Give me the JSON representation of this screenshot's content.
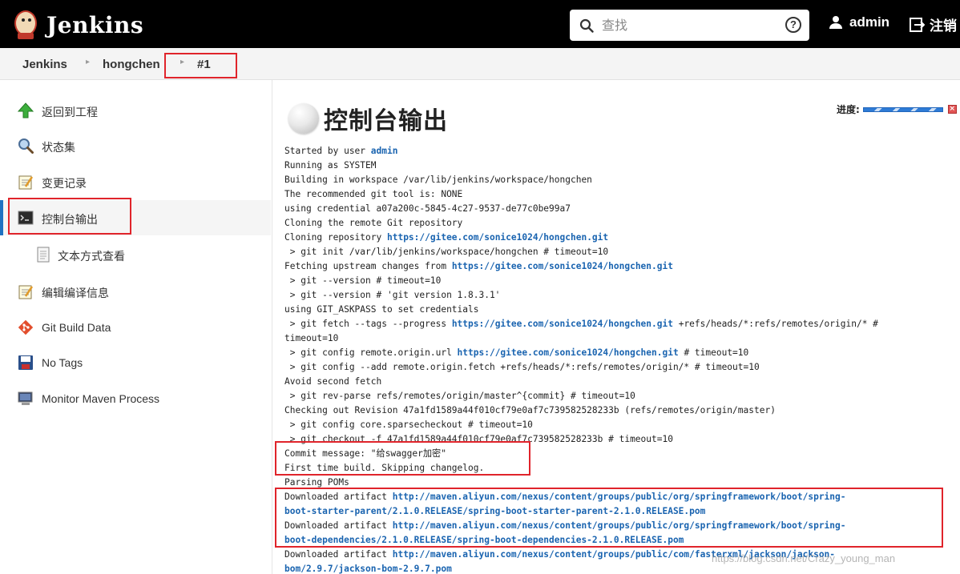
{
  "header": {
    "logo_text": "Jenkins",
    "search_placeholder": "查找",
    "help_label": "?",
    "user_label": "admin",
    "logout_label": "注销"
  },
  "breadcrumb": {
    "items": [
      "Jenkins",
      "hongchen",
      "#1"
    ]
  },
  "sidebar": {
    "items": [
      {
        "label": "返回到工程",
        "icon": "up-arrow-icon"
      },
      {
        "label": "状态集",
        "icon": "magnifier-icon"
      },
      {
        "label": "变更记录",
        "icon": "notepad-icon"
      },
      {
        "label": "控制台输出",
        "icon": "terminal-icon"
      },
      {
        "label": "文本方式查看",
        "icon": "document-icon"
      },
      {
        "label": "编辑编译信息",
        "icon": "notepad-icon"
      },
      {
        "label": "Git Build Data",
        "icon": "git-icon"
      },
      {
        "label": "No Tags",
        "icon": "save-icon"
      },
      {
        "label": "Monitor Maven Process",
        "icon": "monitor-icon"
      }
    ]
  },
  "main": {
    "title": "控制台输出",
    "progress_label": "进度:",
    "console_lines": [
      [
        {
          "t": "Started by user "
        },
        {
          "l": "admin"
        }
      ],
      [
        {
          "t": "Running as SYSTEM"
        }
      ],
      [
        {
          "t": "Building in workspace /var/lib/jenkins/workspace/hongchen"
        }
      ],
      [
        {
          "t": "The recommended git tool is: NONE"
        }
      ],
      [
        {
          "t": "using credential a07a200c-5845-4c27-9537-de77c0be99a7"
        }
      ],
      [
        {
          "t": "Cloning the remote Git repository"
        }
      ],
      [
        {
          "t": "Cloning repository "
        },
        {
          "l": "https://gitee.com/sonice1024/hongchen.git"
        }
      ],
      [
        {
          "t": " > git init /var/lib/jenkins/workspace/hongchen # timeout=10"
        }
      ],
      [
        {
          "t": "Fetching upstream changes from "
        },
        {
          "l": "https://gitee.com/sonice1024/hongchen.git"
        }
      ],
      [
        {
          "t": " > git --version # timeout=10"
        }
      ],
      [
        {
          "t": " > git --version # 'git version 1.8.3.1'"
        }
      ],
      [
        {
          "t": "using GIT_ASKPASS to set credentials"
        }
      ],
      [
        {
          "t": " > git fetch --tags --progress "
        },
        {
          "l": "https://gitee.com/sonice1024/hongchen.git"
        },
        {
          "t": " +refs/heads/*:refs/remotes/origin/* #"
        }
      ],
      [
        {
          "t": "timeout=10"
        }
      ],
      [
        {
          "t": " > git config remote.origin.url "
        },
        {
          "l": "https://gitee.com/sonice1024/hongchen.git"
        },
        {
          "t": " # timeout=10"
        }
      ],
      [
        {
          "t": " > git config --add remote.origin.fetch +refs/heads/*:refs/remotes/origin/* # timeout=10"
        }
      ],
      [
        {
          "t": "Avoid second fetch"
        }
      ],
      [
        {
          "t": " > git rev-parse refs/remotes/origin/master^{commit} # timeout=10"
        }
      ],
      [
        {
          "t": "Checking out Revision 47a1fd1589a44f010cf79e0af7c739582528233b (refs/remotes/origin/master)"
        }
      ],
      [
        {
          "t": " > git config core.sparsecheckout # timeout=10"
        }
      ],
      [
        {
          "t": " > git checkout -f 47a1fd1589a44f010cf79e0af7c739582528233b # timeout=10"
        }
      ],
      [
        {
          "t": "Commit message: \"给swagger加密\""
        }
      ],
      [
        {
          "t": "First time build. Skipping changelog."
        }
      ],
      [
        {
          "t": "Parsing POMs"
        }
      ],
      [
        {
          "t": "Downloaded artifact "
        },
        {
          "l": "http://maven.aliyun.com/nexus/content/groups/public/org/springframework/boot/spring-"
        }
      ],
      [
        {
          "l": "boot-starter-parent/2.1.0.RELEASE/spring-boot-starter-parent-2.1.0.RELEASE.pom"
        }
      ],
      [
        {
          "t": "Downloaded artifact "
        },
        {
          "l": "http://maven.aliyun.com/nexus/content/groups/public/org/springframework/boot/spring-"
        }
      ],
      [
        {
          "l": "boot-dependencies/2.1.0.RELEASE/spring-boot-dependencies-2.1.0.RELEASE.pom"
        }
      ],
      [
        {
          "t": "Downloaded artifact "
        },
        {
          "l": "http://maven.aliyun.com/nexus/content/groups/public/com/fasterxml/jackson/jackson-"
        }
      ],
      [
        {
          "l": "bom/2.9.7/jackson-bom-2.9.7.pom"
        }
      ]
    ]
  },
  "watermark": "https://blog.csdn.net/Crazy_young_man",
  "colors": {
    "header_bg": "#000000",
    "link": "#1a64b0",
    "highlight_box": "#e0242b",
    "active_bar": "#1f72c2"
  }
}
